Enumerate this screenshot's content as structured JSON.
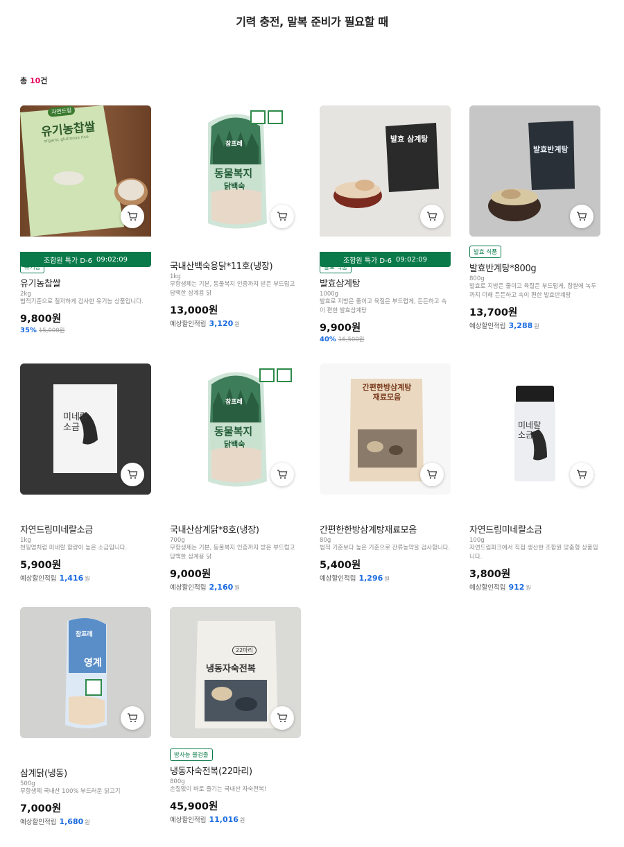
{
  "page": {
    "title": "기력 충전, 말복 준비가 필요할 때",
    "count_prefix": "총 ",
    "count_value": "10",
    "count_suffix": "건"
  },
  "special_bar": {
    "label": "조합원 특가 D-6",
    "time": "09:02:09"
  },
  "points_label": "예상할인적립",
  "won_unit": "원",
  "products": [
    {
      "name": "유기농찹쌀",
      "weight": "2kg",
      "desc": "법적기준으로 철저하게 검사한 유기농 상품입니다.",
      "price": "9,800원",
      "discount_pct": "35%",
      "original_price": "15,000원",
      "badge": "유기농",
      "special": true
    },
    {
      "name": "국내산백숙용닭*11호(냉장)",
      "weight": "1kg",
      "desc": "무항생제는 기본, 동물복지 인증까지 받은 부드럽고 담백한 삼계용 닭",
      "price": "13,000원",
      "points": "3,120",
      "special": false
    },
    {
      "name": "발효삼계탕",
      "weight": "1000g",
      "desc": "발효로 지방은 줄이고 육질은 부드럽게, 든든하고 속이 편한 발효삼계탕",
      "price": "9,900원",
      "discount_pct": "40%",
      "original_price": "16,500원",
      "badge": "발효 식품",
      "special": true
    },
    {
      "name": "발효반계탕*800g",
      "weight": "800g",
      "desc": "발효로 지방은 줄이고 육질은 부드럽게, 찹쌀에 녹두까지 더해 든든하고 속이 편한 발효반계탕",
      "price": "13,700원",
      "points": "3,288",
      "badge": "발효 식품",
      "special": false
    },
    {
      "name": "자연드림미네랄소금",
      "weight": "1kg",
      "desc": "천일염처럼 미네랄 함량이 높은 소금입니다.",
      "price": "5,900원",
      "points": "1,416"
    },
    {
      "name": "국내산삼계닭*8호(냉장)",
      "weight": "700g",
      "desc": "무항생제는 기본, 동물복지 인증까지 받은 부드럽고 담백한 삼계용 닭",
      "price": "9,000원",
      "points": "2,160"
    },
    {
      "name": "간편한한방삼계탕재료모음",
      "weight": "80g",
      "desc": "법적 기준보다 높은 기준으로 잔류농약을 검사합니다.",
      "price": "5,400원",
      "points": "1,296"
    },
    {
      "name": "자연드림미네랄소금",
      "weight": "100g",
      "desc": "자연드림파크에서 직접 생산한 조합원 맞춤형 상품입니다.",
      "price": "3,800원",
      "points": "912"
    },
    {
      "name": "삼계닭(냉동)",
      "weight": "500g",
      "desc": "무항생제 국내산 100% 부드러운 닭고기",
      "price": "7,000원",
      "points": "1,680"
    },
    {
      "name": "냉동자숙전복(22마리)",
      "weight": "800g",
      "desc": "손질없이 바로 즐기는 국내산 자숙전복!",
      "price": "45,900원",
      "points": "11,016",
      "badge": "방사능 불검출"
    }
  ],
  "art_text": {
    "p1_brand": "자연드림",
    "p1_title": "유기농찹쌀",
    "p1_sub": "organic glutinous rice",
    "p2_brand": "참프레",
    "p2_title": "동물복지",
    "p2_sub": "닭백숙",
    "p3_title": "발효 삼계탕",
    "p4_title": "발효반계탕",
    "p5_title": "미네랄",
    "p5_sub": "소금",
    "p6_brand": "참프레",
    "p6_title": "동물복지",
    "p6_sub": "닭백숙",
    "p7_title": "간편한방삼계탕",
    "p7_sub": "재료모음",
    "p8_title": "미네랄",
    "p8_sub": "소금",
    "p9_brand": "참프레",
    "p9_title": "영계",
    "p10_title": "냉동자숙전복",
    "p10_tag": "22마리"
  }
}
